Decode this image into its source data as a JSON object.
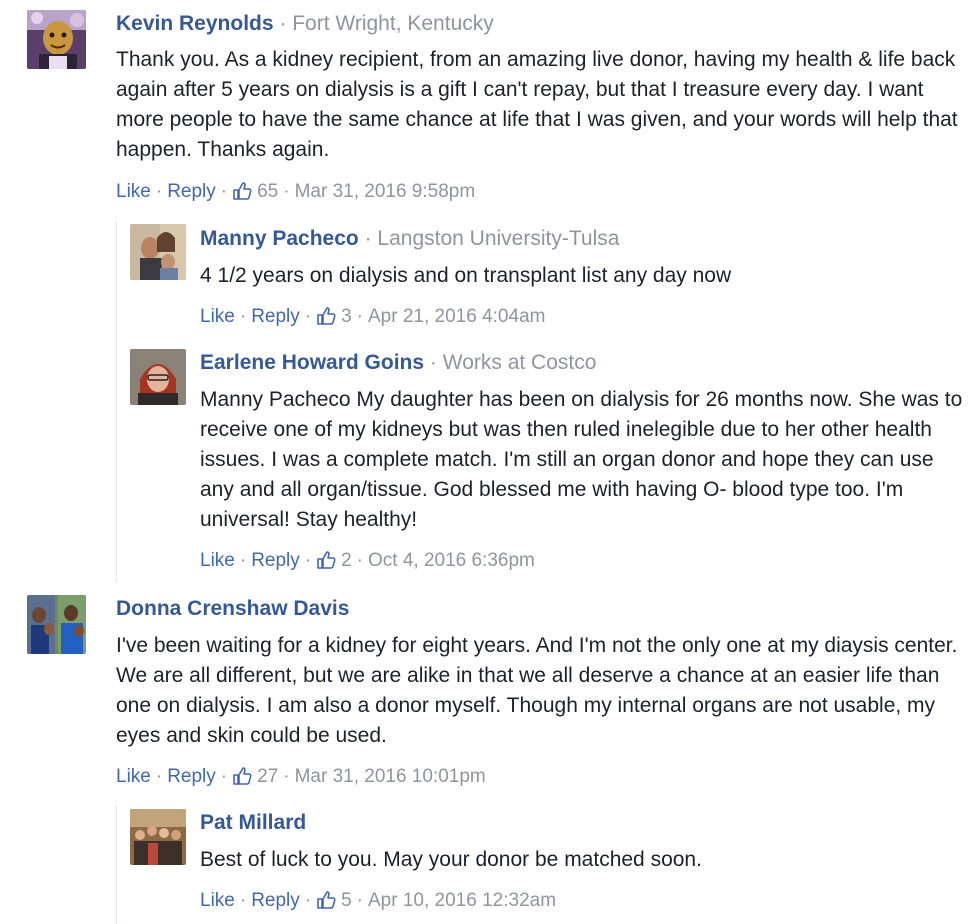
{
  "comments": [
    {
      "name": "Kevin Reynolds",
      "affiliation": "Fort Wright, Kentucky",
      "text": "Thank you. As a kidney recipient, from an amazing live donor, having my health & life back again after 5 years on dialysis is a gift I can't repay, but that I treasure every day. I want more people to have the same chance at life that I was given, and your words will help that happen. Thanks again.",
      "like_label": "Like",
      "reply_label": "Reply",
      "likes": "65",
      "timestamp": "Mar 31, 2016 9:58pm",
      "replies": [
        {
          "name": "Manny Pacheco",
          "affiliation": "Langston University-Tulsa",
          "text": "4 1/2 years on dialysis and on transplant list any day now",
          "like_label": "Like",
          "reply_label": "Reply",
          "likes": "3",
          "timestamp": "Apr 21, 2016 4:04am"
        },
        {
          "name": "Earlene Howard Goins",
          "affiliation": "Works at Costco",
          "text": "Manny Pacheco My daughter has been on dialysis for 26 months now. She was to receive one of my kidneys but was then ruled inelegible due to her other health issues. I was a complete match. I'm still an organ donor and hope they can use any and all organ/tissue. God blessed me with having O- blood type too. I'm universal! Stay healthy!",
          "like_label": "Like",
          "reply_label": "Reply",
          "likes": "2",
          "timestamp": "Oct 4, 2016 6:36pm"
        }
      ]
    },
    {
      "name": "Donna Crenshaw Davis",
      "affiliation": "",
      "text": "I've been waiting for a kidney for eight years. And I'm not the only one at my diaysis center. We are all different, but we are alike in that we all deserve a chance at an easier life than one on dialysis. I am also a donor myself. Though my internal organs are not usable, my eyes and skin could be used.",
      "like_label": "Like",
      "reply_label": "Reply",
      "likes": "27",
      "timestamp": "Mar 31, 2016 10:01pm",
      "replies": [
        {
          "name": "Pat Millard",
          "affiliation": "",
          "text": "Best of luck to you. May your donor be matched soon.",
          "like_label": "Like",
          "reply_label": "Reply",
          "likes": "5",
          "timestamp": "Apr 10, 2016 12:32am"
        }
      ]
    }
  ],
  "separator": "·",
  "colors": {
    "name": "#365899",
    "link": "#4267b2",
    "meta": "#90949c",
    "text": "#1d2129"
  }
}
